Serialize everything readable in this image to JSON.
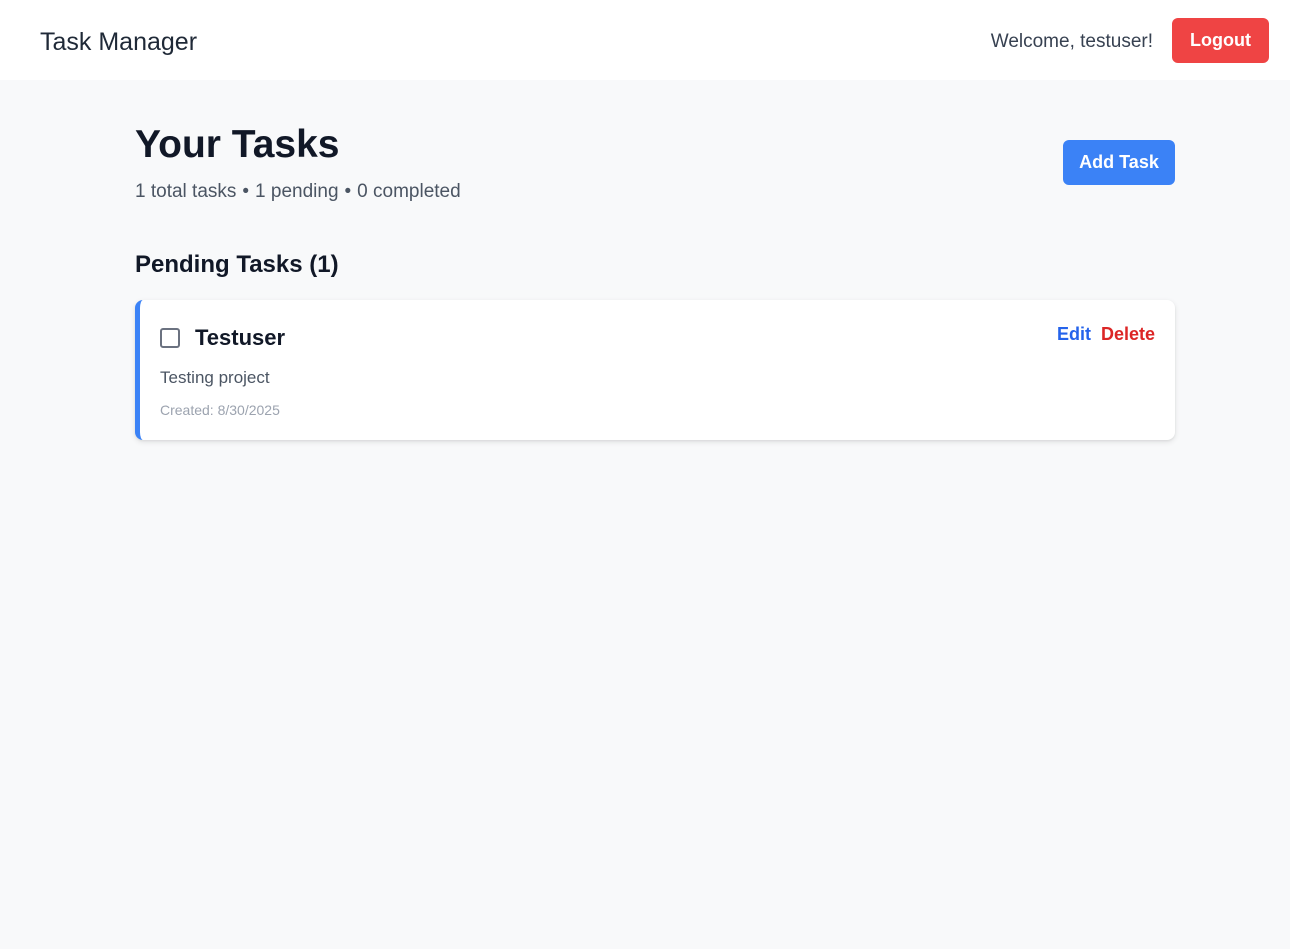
{
  "navbar": {
    "brand": "Task Manager",
    "welcome": "Welcome, testuser!",
    "logout_label": "Logout"
  },
  "header": {
    "title": "Your Tasks",
    "stats": {
      "total": "1 total tasks",
      "pending": "1 pending",
      "completed": "0 completed",
      "separator": "•"
    },
    "add_task_label": "Add Task"
  },
  "pending_section": {
    "title": "Pending Tasks (1)",
    "tasks": [
      {
        "title": "Testuser",
        "description": "Testing project",
        "created": "Created: 8/30/2025",
        "completed": false,
        "edit_label": "Edit",
        "delete_label": "Delete"
      }
    ]
  },
  "colors": {
    "primary": "#3b82f6",
    "danger": "#ef4444",
    "edit_link": "#2563eb",
    "delete_link": "#dc2626",
    "background": "#f8f9fa"
  }
}
